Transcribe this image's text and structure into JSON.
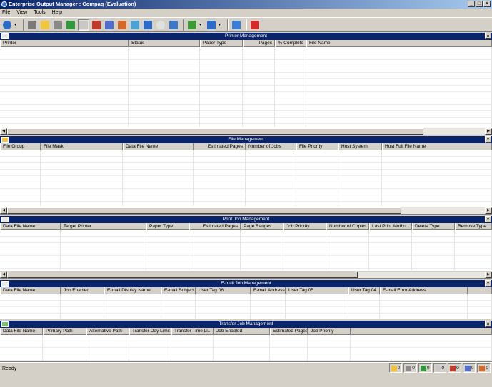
{
  "window": {
    "title": "Enterprise Output Manager : Compaq (Evaluation)",
    "controls": [
      "_",
      "□",
      "×"
    ]
  },
  "menu": [
    "File",
    "View",
    "Tools",
    "Help"
  ],
  "toolbar": {
    "buttons": [
      {
        "icon": "server-icon",
        "color": "#2a6cc8"
      },
      {
        "icon": "printer-icon",
        "color": "#7a7a7a"
      },
      {
        "icon": "folder-icon",
        "color": "#f2c53d"
      },
      {
        "icon": "print-job-icon",
        "color": "#8a8a8a"
      },
      {
        "icon": "refresh-icon",
        "color": "#2f9a3b"
      },
      {
        "icon": "email-icon",
        "color": "#c8c8c8"
      },
      {
        "icon": "transfer-icon",
        "color": "#c0392b"
      },
      {
        "icon": "database-icon",
        "color": "#4f6fd0"
      },
      {
        "icon": "shapes-icon",
        "color": "#d26a2a"
      },
      {
        "icon": "network-icon",
        "color": "#4aa3d6"
      },
      {
        "icon": "box-icon",
        "color": "#2a6cc8"
      },
      {
        "icon": "clock-icon",
        "color": "#e0e0e0"
      },
      {
        "icon": "group-icon",
        "color": "#3b78c9"
      },
      {
        "icon": "download-icon",
        "color": "#3d9b35"
      },
      {
        "icon": "cube-icon",
        "color": "#2a6cc8"
      },
      {
        "icon": "monitor-icon",
        "color": "#3a7fd5"
      },
      {
        "icon": "help-book-icon",
        "color": "#d42a2a"
      }
    ]
  },
  "panels": {
    "printer": {
      "title": "Printer Management",
      "columns": [
        "Printer",
        "Status",
        "Paper Type",
        "Pages",
        "% Complete",
        "File Name"
      ]
    },
    "file": {
      "title": "File Management",
      "columns": [
        "File Group",
        "File Mask",
        "Data File Name",
        "Estimated Pages",
        "Number of Jobs",
        "File Priority",
        "Host System",
        "Host Full File Name"
      ]
    },
    "printjob": {
      "title": "Print Job Management",
      "columns": [
        "Data File Name",
        "Target Printer",
        "Paper Type",
        "Estimated Pages",
        "Page Ranges",
        "Job Priority",
        "Number of Copies",
        "Last Print Attribu...",
        "Delete Type",
        "Remove Type"
      ]
    },
    "email": {
      "title": "E-mail Job Management",
      "columns": [
        "Data File Name",
        "Job Enabled",
        "E-mail Display Name",
        "E-mail Subject",
        "User Tag 06",
        "E-mail Address",
        "User Tag 05",
        "User Tag 04",
        "E-mail Error Address"
      ]
    },
    "transfer": {
      "title": "Transfer Job Management",
      "columns": [
        "Data File Name",
        "Primary Path",
        "Alternative Path",
        "Transfer Day Limit",
        "Transfer Time Li...",
        "Job Enabled",
        "Estimated Pages",
        "Job Priority"
      ]
    }
  },
  "status": {
    "text": "Ready",
    "counters": [
      {
        "icon": "folder-icon",
        "value": "0",
        "color": "#f2c53d"
      },
      {
        "icon": "printer-icon",
        "value": "0",
        "color": "#8a8a8a"
      },
      {
        "icon": "refresh-icon",
        "value": "0",
        "color": "#2f9a3b"
      },
      {
        "icon": "email-icon",
        "value": "0",
        "color": "#c8c8c8"
      },
      {
        "icon": "transfer-icon",
        "value": "0",
        "color": "#c0392b"
      },
      {
        "icon": "database-icon",
        "value": "0",
        "color": "#4f6fd0"
      },
      {
        "icon": "shapes-icon",
        "value": "0",
        "color": "#d26a2a"
      }
    ]
  }
}
